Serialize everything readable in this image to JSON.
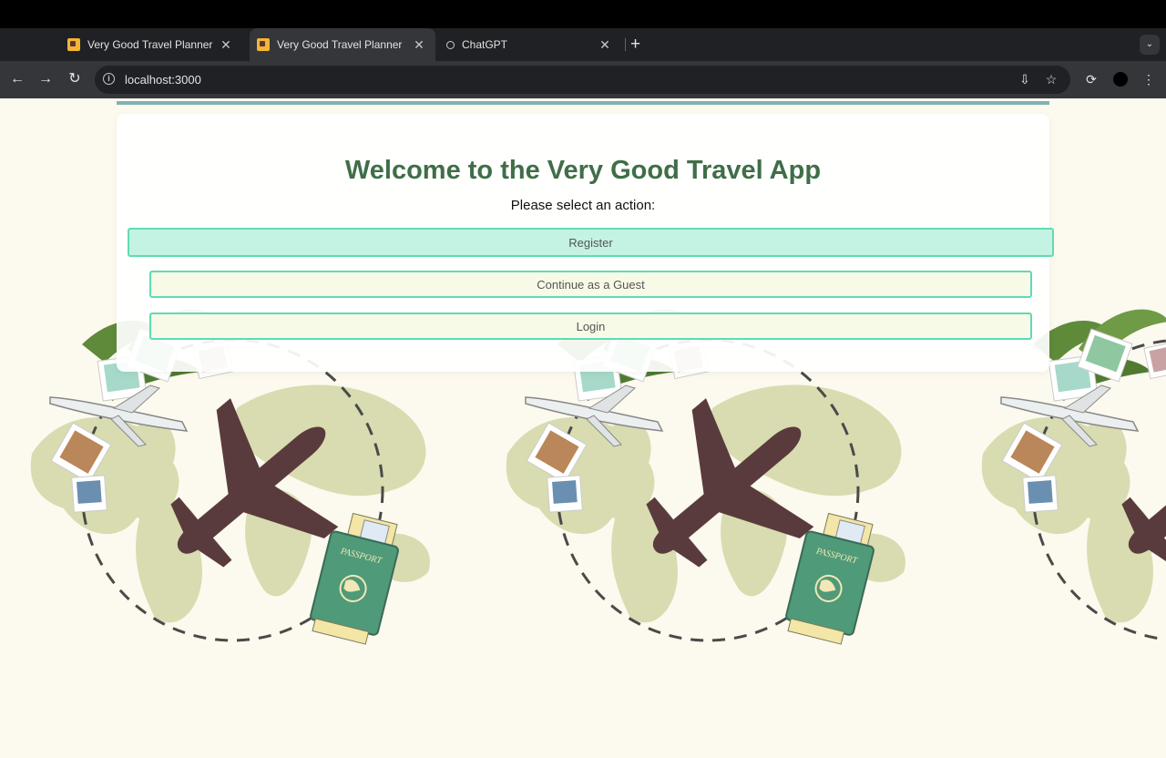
{
  "browser": {
    "tabs": [
      {
        "title": "Very Good Travel Planner",
        "favicon": "travel-favicon-icon",
        "active": false
      },
      {
        "title": "Very Good Travel Planner",
        "favicon": "travel-favicon-icon",
        "active": true
      },
      {
        "title": "ChatGPT",
        "favicon": "chatgpt-favicon-icon",
        "active": false
      }
    ],
    "url": "localhost:3000"
  },
  "page": {
    "title": "Welcome to the Very Good Travel App",
    "subtitle": "Please select an action:",
    "actions": {
      "register": "Register",
      "guest": "Continue as a Guest",
      "login": "Login"
    },
    "background": {
      "passport_text": "PASSPORT",
      "colors": {
        "map": "#d8dcb0",
        "plane": "#5a3b3d",
        "passport": "#4f9a78",
        "palm": "#5f8a3a"
      }
    }
  },
  "colors": {
    "heading": "#3f6e48",
    "button_border": "#5fdbb3",
    "register_bg": "#c4f3e3",
    "button_bg": "#f8fae8",
    "page_bg": "#fcf9ee"
  }
}
